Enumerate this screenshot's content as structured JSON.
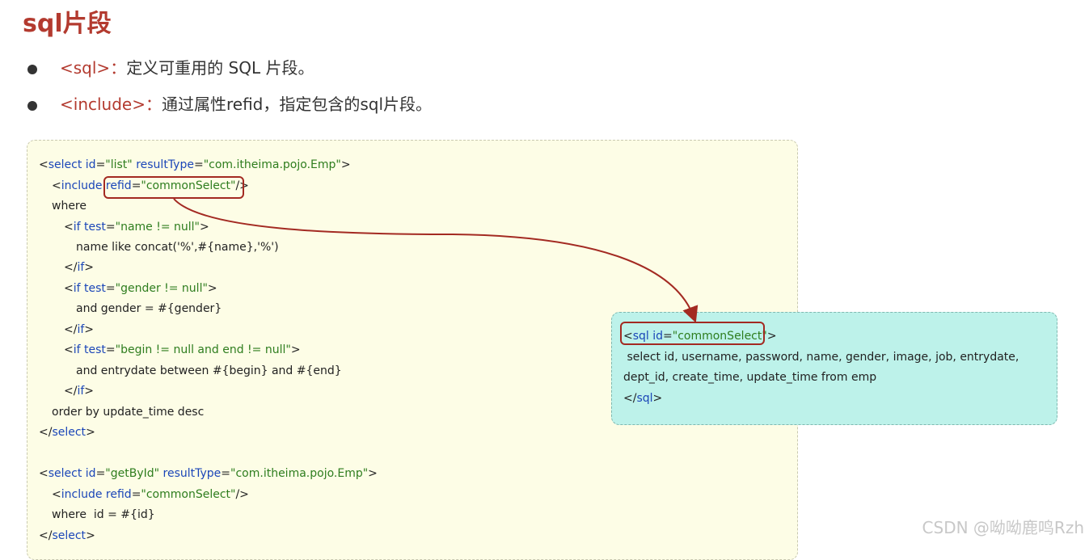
{
  "title": "sql片段",
  "bullets": [
    {
      "tag": "<sql>",
      "sep": "：",
      "text": "定义可重用的 SQL 片段。"
    },
    {
      "tag": "<include>",
      "sep": "：",
      "text": "通过属性refid，指定包含的sql片段。"
    }
  ],
  "code": {
    "l1": {
      "a": "<",
      "b": "select id",
      "c": "=",
      "d": "\"list\"",
      "e": " resultType",
      "f": "=",
      "g": "\"com.itheima.pojo.Emp\"",
      "h": ">"
    },
    "l2": {
      "a": "<",
      "b": "include refid",
      "c": "=",
      "d": "\"commonSelect\"",
      "e": "/>"
    },
    "l3": "where",
    "l4": {
      "a": "<",
      "b": "if test",
      "c": "=",
      "d": "\"name != null\"",
      "e": ">"
    },
    "l5": "name like concat('%',#{name},'%')",
    "l6": {
      "a": "</",
      "b": "if",
      "c": ">"
    },
    "l7": {
      "a": "<",
      "b": "if test",
      "c": "=",
      "d": "\"gender != null\"",
      "e": ">"
    },
    "l8": "and gender = #{gender}",
    "l9": {
      "a": "</",
      "b": "if",
      "c": ">"
    },
    "l10": {
      "a": "<",
      "b": "if test",
      "c": "=",
      "d": "\"begin != null and end != null\"",
      "e": ">"
    },
    "l11": "and entrydate between #{begin} and #{end}",
    "l12": {
      "a": "</",
      "b": "if",
      "c": ">"
    },
    "l13": "order by update_time desc",
    "l14": {
      "a": "</",
      "b": "select",
      "c": ">"
    },
    "l15": {
      "a": "<",
      "b": "select id",
      "c": "=",
      "d": "\"getById\"",
      "e": " resultType",
      "f": "=",
      "g": "\"com.itheima.pojo.Emp\"",
      "h": ">"
    },
    "l16": {
      "a": "<",
      "b": "include refid",
      "c": "=",
      "d": "\"commonSelect\"",
      "e": "/>"
    },
    "l17": "where  id = #{id}",
    "l18": {
      "a": "</",
      "b": "select",
      "c": ">"
    }
  },
  "sql": {
    "l1": {
      "a": "<",
      "b": "sql id",
      "c": "=",
      "d": "\"commonSelect\"",
      "e": ">"
    },
    "l2": " select id, username, password, name, gender, image, job, entrydate,",
    "l3": "dept_id, create_time, update_time from emp",
    "l4": {
      "a": "</",
      "b": "sql",
      "c": ">"
    }
  },
  "watermark": "CSDN @呦呦鹿鸣Rzh",
  "colors": {
    "accent": "#b33a2f",
    "keyword": "#1b46b8",
    "string": "#2e7d1e",
    "arrow": "#a32a22"
  }
}
